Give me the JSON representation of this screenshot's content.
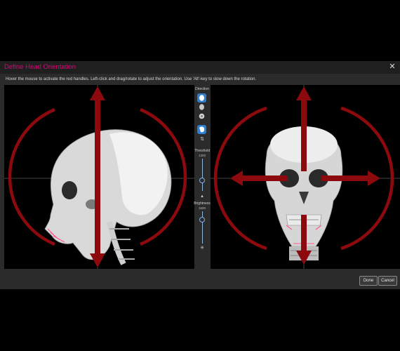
{
  "dialog": {
    "title": "Define Head Orientation",
    "close_symbol": "✕",
    "instructions": "Hover the mouse to activate the red handles. Left-click and drag/rotate to adjust the orientation. Use 'Alt'-key to slow down the rotation."
  },
  "side_panel": {
    "direction_label": "Direction",
    "threshold_label": "Threshold",
    "threshold_value": "1300",
    "threshold_level": 0.68,
    "brightness_label": "Brightness",
    "brightness_value": "1600",
    "brightness_level": 0.25,
    "icons": [
      "head-front-icon",
      "head-side-icon",
      "head-top-icon",
      "head-profile-icon",
      "rotate-icon",
      "sun-icon"
    ]
  },
  "buttons": {
    "done": "Done",
    "cancel": "Cancel"
  },
  "colors": {
    "accent": "#e2007a",
    "handle_red": "#8c0a0e",
    "selected_blue": "#2f7fd1"
  }
}
